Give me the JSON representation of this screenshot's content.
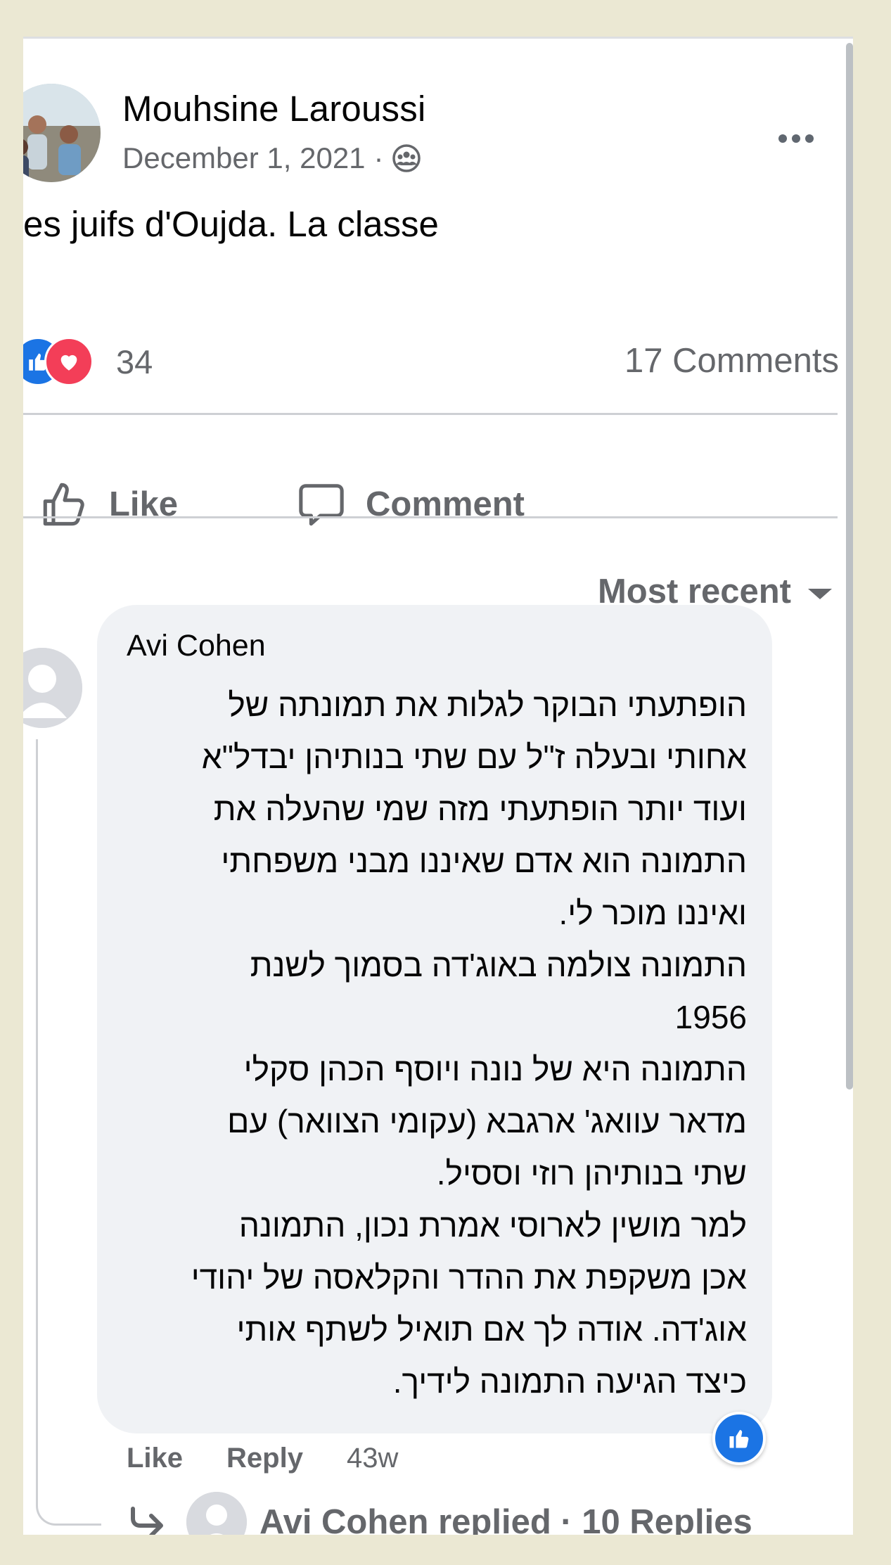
{
  "post": {
    "author": "Mouhsine Laroussi",
    "date": "December 1, 2021",
    "meta_separator": "·",
    "privacy_icon": "friends-icon",
    "text": "es juifs d'Oujda. La classe",
    "reactions": {
      "icons": [
        "like-reaction-icon",
        "love-reaction-icon"
      ],
      "count": "34"
    },
    "comments_count": "17 Comments"
  },
  "actions": {
    "like_label": "Like",
    "comment_label": "Comment"
  },
  "sort": {
    "label": "Most recent"
  },
  "comment": {
    "author": "Avi Cohen",
    "body": "הופתעתי הבוקר לגלות את תמונתה של\nאחותי ובעלה ז\"ל עם שתי בנותיהן יבדל\"א\nועוד יותר הופתעתי מזה שמי שהעלה את\nהתמונה הוא אדם שאיננו מבני משפחתי\nואיננו מוכר לי.\nהתמונה צולמה באוג'דה בסמוך לשנת\n1956\nהתמונה היא של נונה ויוסף הכהן סקלי\nמדאר עוואג' ארגבא (עקומי הצוואר) עם\nשתי בנותיהן רוזי וססיל.\nלמר מושין לארוסי אמרת נכון, התמונה\nאכן משקפת את ההדר והקלאסה של יהודי\nאוג'דה. אודה לך אם תואיל לשתף אותי\nכיצד הגיעה התמונה לידיך.",
    "like_label": "Like",
    "reply_label": "Reply",
    "time": "43w",
    "reaction_badge": "like-reaction-icon",
    "replies_summary": "Avi Cohen replied · 10 Replies"
  },
  "colors": {
    "background": "#ebe8d3",
    "secondary_text": "#65676b",
    "like_blue": "#1b74e4",
    "love_red": "#f33e58",
    "bubble": "#f0f2f5"
  }
}
